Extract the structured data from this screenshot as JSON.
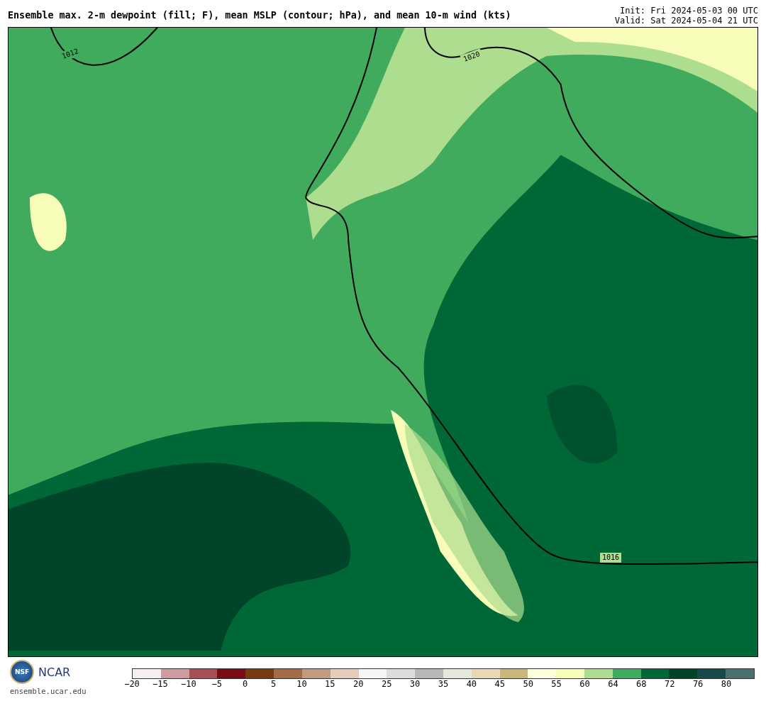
{
  "title": "Ensemble max. 2-m dewpoint (fill; F), mean MSLP (contour; hPa), and mean 10-m wind (kts)",
  "init": "Init: Fri 2024-05-03 00 UTC",
  "valid": "Valid: Sat 2024-05-04 21 UTC",
  "contour_labels": [
    {
      "text": "1012",
      "kind": "tilted"
    },
    {
      "text": "1020",
      "kind": "tilted"
    },
    {
      "text": "1016",
      "kind": "flat"
    }
  ],
  "logos": {
    "nsf": "NSF",
    "ncar": "NCAR",
    "url": "ensemble.ucar.edu"
  },
  "legend": [
    {
      "label": "−20",
      "color": "#f6eef0"
    },
    {
      "label": "−15",
      "color": "#cf9aa0"
    },
    {
      "label": "−10",
      "color": "#a84e57"
    },
    {
      "label": "−5",
      "color": "#7a0c18"
    },
    {
      "label": "0",
      "color": "#7a3a10"
    },
    {
      "label": "5",
      "color": "#a56b48"
    },
    {
      "label": "10",
      "color": "#c19a80"
    },
    {
      "label": "15",
      "color": "#e5cbbb"
    },
    {
      "label": "20",
      "color": "#f6f6f6"
    },
    {
      "label": "25",
      "color": "#dcdcdc"
    },
    {
      "label": "30",
      "color": "#b8b8b8"
    },
    {
      "label": "35",
      "color": "#e5e6dc"
    },
    {
      "label": "40",
      "color": "#e8d9b4"
    },
    {
      "label": "45",
      "color": "#cbb67a"
    },
    {
      "label": "50",
      "color": "#fefedb"
    },
    {
      "label": "55",
      "color": "#f7fcb9"
    },
    {
      "label": "60",
      "color": "#addd8e"
    },
    {
      "label": "64",
      "color": "#41ab5d"
    },
    {
      "label": "68",
      "color": "#006837"
    },
    {
      "label": "72",
      "color": "#004529"
    },
    {
      "label": "76",
      "color": "#164a4a"
    },
    {
      "label": "80",
      "color": "#4a7070"
    }
  ]
}
